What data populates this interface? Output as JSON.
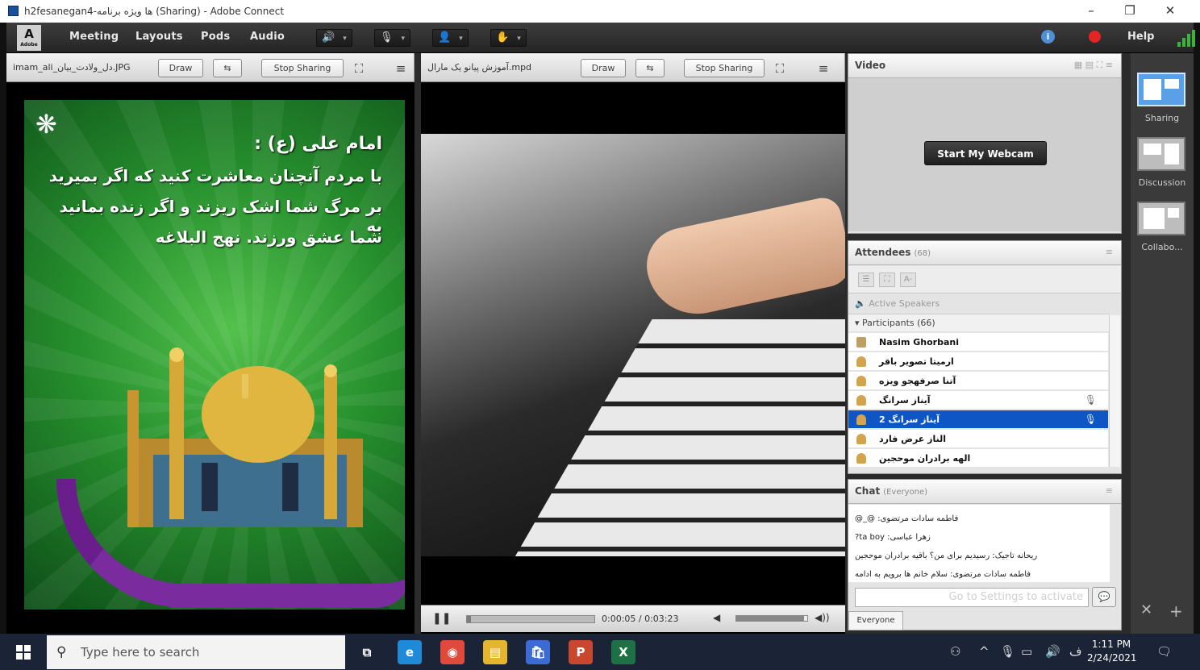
{
  "window": {
    "title": "h2fesanegan4-ها ویژه برنامه (Sharing) - Adobe Connect",
    "minimize": "–",
    "maximize": "❐",
    "close": "✕"
  },
  "menubar": {
    "logo_letter": "A",
    "logo_sub": "Adobe",
    "items": [
      "Meeting",
      "Layouts",
      "Pods",
      "Audio"
    ],
    "help": "Help",
    "info_glyph": "i",
    "speaker_glyph": "🔊",
    "mic_glyph": "🎙",
    "cam_glyph": "👤",
    "hand_glyph": "✋",
    "dropdown_glyph": "▾"
  },
  "share_left": {
    "filename": "imam_ali_دل_ولادت_بیان.JPG",
    "draw_label": "Draw",
    "stop_label": "Stop Sharing",
    "poster_lines": [
      "امام علی (ع) :",
      "با مردم آنچنان معاشرت کنید که اگر بمیرید",
      "بر مرگ شما اشک ریزند و اگر زنده بمانید به",
      "شما عشق ورزند.      نهج البلاغه"
    ],
    "emblem_glyph": "❋"
  },
  "share_right": {
    "filename": "آموزش پیانو یک مارال.mpd",
    "draw_label": "Draw",
    "stop_label": "Stop Sharing",
    "pause_glyph": "❚❚",
    "time": "0:00:05 / 0:03:23",
    "progress": 0.03,
    "volume": 0.95,
    "vol_low_glyph": "◀",
    "vol_high_glyph": "◀))"
  },
  "video_pod": {
    "title": "Video",
    "webcam_button": "Start My Webcam"
  },
  "attendees": {
    "title": "Attendees",
    "count": "(68)",
    "active_speakers": "Active Speakers",
    "participants_header": "Participants (66)",
    "host": "Nasim Ghorbani",
    "rows": [
      {
        "name": "ارمیتا تصویر باقر",
        "mic": ""
      },
      {
        "name": "آتنا صرفهجو ویزه",
        "mic": ""
      },
      {
        "name": "آیناز سرانگ",
        "mic": "🎙"
      },
      {
        "name": "آیناز سرانگ 2",
        "mic": "🎙",
        "selected": true
      },
      {
        "name": "الناز عرض فارد",
        "mic": ""
      },
      {
        "name": "الهه برادران موحجین",
        "mic": ""
      }
    ]
  },
  "chat": {
    "title": "Chat",
    "scope": "(Everyone)",
    "messages": [
      "فاطمه سادات مرتضوی: @_@",
      "زهرا عباسی: ta boy?",
      "ریحانه تاجیک: رسیدیم برای من؟ باقیه برادران موحجین",
      "فاطمه سادات مرتضوی: سلام خانم ها برویم به ادامه"
    ],
    "input_placeholder": "Go to Settings to activate",
    "send_glyph": "💬",
    "audience_tab": "Everyone"
  },
  "layouts": {
    "items": [
      "Sharing",
      "Discussion",
      "Collabo..."
    ]
  },
  "taskbar": {
    "search_placeholder": "Type here to search",
    "time": "1:11 PM",
    "date": "2/24/2021",
    "apps": [
      {
        "name": "task-view",
        "glyph": "⧉",
        "color": "#1b2437"
      },
      {
        "name": "edge",
        "glyph": "e",
        "color": "#1f8ad8"
      },
      {
        "name": "chrome",
        "glyph": "◉",
        "color": "#e04a3a"
      },
      {
        "name": "file-explorer",
        "glyph": "▤",
        "color": "#e5b52b"
      },
      {
        "name": "store",
        "glyph": "🛍",
        "color": "#3c6bd4"
      },
      {
        "name": "powerpoint",
        "glyph": "P",
        "color": "#c9472c"
      },
      {
        "name": "excel",
        "glyph": "X",
        "color": "#1e7145"
      }
    ]
  }
}
